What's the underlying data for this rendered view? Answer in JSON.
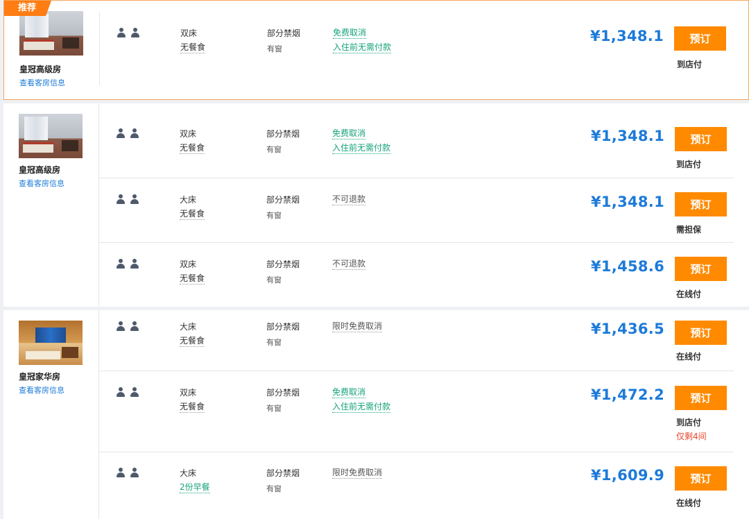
{
  "colors": {
    "price": "#1d7ad9",
    "book_button": "#ff8a00",
    "badge": "#ff7d13",
    "free_cancel": "#16a37a",
    "scarce": "#e8442a"
  },
  "icons": {
    "guests": "person-icon"
  },
  "view_room_info_label": "查看客房信息",
  "book_label": "预订",
  "rooms": [
    {
      "badge": "推荐",
      "name": "皇冠高级房",
      "rates": [
        {
          "bed": "双床",
          "meal": "无餐食",
          "smoking": "部分禁烟",
          "window": "有窗",
          "cancel": "免费取消",
          "cancel_note": "入住前无需付款",
          "price": "¥1,348.1",
          "payment": "到店付"
        }
      ]
    },
    {
      "name": "皇冠高级房",
      "rates": [
        {
          "bed": "双床",
          "meal": "无餐食",
          "smoking": "部分禁烟",
          "window": "有窗",
          "cancel": "免费取消",
          "cancel_note": "入住前无需付款",
          "price": "¥1,348.1",
          "payment": "到店付"
        },
        {
          "bed": "大床",
          "meal": "无餐食",
          "smoking": "部分禁烟",
          "window": "有窗",
          "cancel": "不可退款",
          "price": "¥1,348.1",
          "payment": "需担保"
        },
        {
          "bed": "双床",
          "meal": "无餐食",
          "smoking": "部分禁烟",
          "window": "有窗",
          "cancel": "不可退款",
          "price": "¥1,458.6",
          "payment": "在线付"
        }
      ]
    },
    {
      "name": "皇冠家华房",
      "rates": [
        {
          "bed": "大床",
          "meal": "无餐食",
          "smoking": "部分禁烟",
          "window": "有窗",
          "cancel": "限时免费取消",
          "price": "¥1,436.5",
          "payment": "在线付"
        },
        {
          "bed": "双床",
          "meal": "无餐食",
          "smoking": "部分禁烟",
          "window": "有窗",
          "cancel": "免费取消",
          "cancel_note": "入住前无需付款",
          "price": "¥1,472.2",
          "payment": "到店付",
          "scarce": "仅剩4间"
        },
        {
          "bed": "大床",
          "meal": "2份早餐",
          "smoking": "部分禁烟",
          "window": "有窗",
          "cancel": "限时免费取消",
          "price": "¥1,609.9",
          "payment": "在线付"
        }
      ]
    }
  ]
}
